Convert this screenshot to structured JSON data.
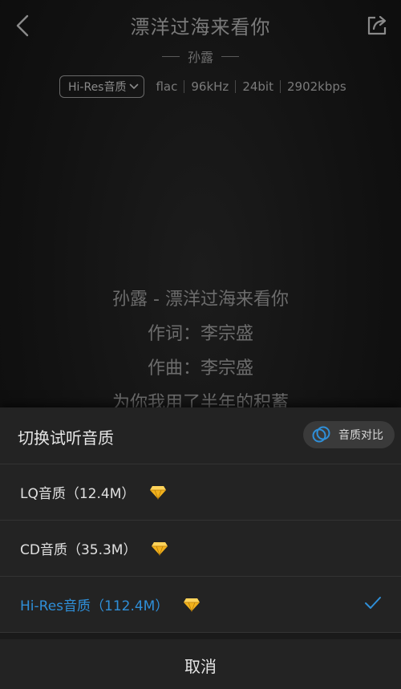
{
  "header": {
    "title": "漂洋过海来看你",
    "artist": "孙露",
    "quality_selected": "Hi-Res音质",
    "format": "flac",
    "sample_rate": "96kHz",
    "bit_depth": "24bit",
    "bitrate": "2902kbps"
  },
  "lyrics": {
    "lines": [
      "孙露 - 漂洋过海来看你",
      "作词：李宗盛",
      "作曲：李宗盛",
      "为你我用了半年的积蓄"
    ]
  },
  "sheet": {
    "title": "切换试听音质",
    "compare_label": "音质对比",
    "options": [
      {
        "label": "LQ音质（12.4M）",
        "selected": false
      },
      {
        "label": "CD音质（35.3M）",
        "selected": false
      },
      {
        "label": "Hi-Res音质（112.4M）",
        "selected": true
      }
    ],
    "cancel_label": "取消"
  },
  "colors": {
    "accent": "#2f8fd8",
    "gem": "#f2b21c",
    "sheet_bg": "#232323"
  },
  "icons": {
    "back": "chevron-left-icon",
    "share": "share-icon",
    "dropdown": "chevron-down-icon",
    "compare": "overlap-circles-icon",
    "gem": "diamond-icon",
    "check": "check-icon"
  }
}
